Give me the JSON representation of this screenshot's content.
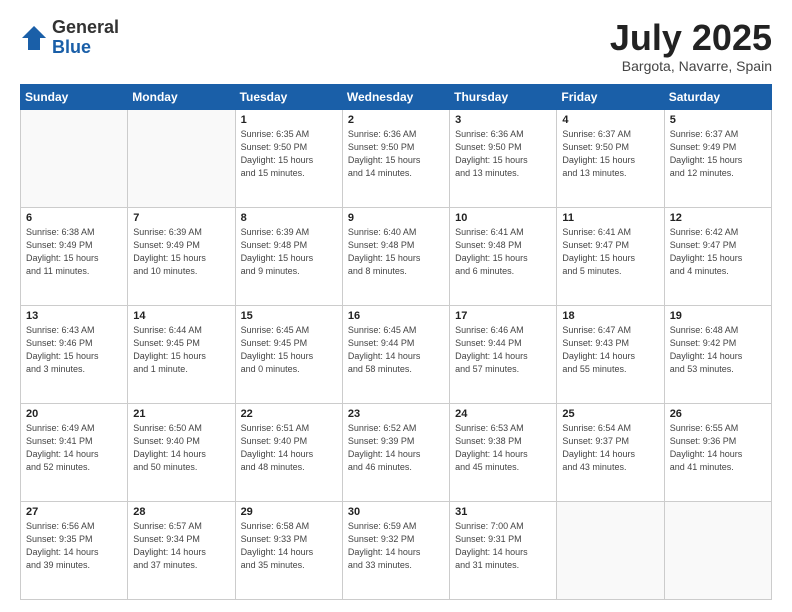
{
  "header": {
    "logo_general": "General",
    "logo_blue": "Blue",
    "month_title": "July 2025",
    "subtitle": "Bargota, Navarre, Spain"
  },
  "weekdays": [
    "Sunday",
    "Monday",
    "Tuesday",
    "Wednesday",
    "Thursday",
    "Friday",
    "Saturday"
  ],
  "weeks": [
    [
      {
        "day": "",
        "info": ""
      },
      {
        "day": "",
        "info": ""
      },
      {
        "day": "1",
        "info": "Sunrise: 6:35 AM\nSunset: 9:50 PM\nDaylight: 15 hours\nand 15 minutes."
      },
      {
        "day": "2",
        "info": "Sunrise: 6:36 AM\nSunset: 9:50 PM\nDaylight: 15 hours\nand 14 minutes."
      },
      {
        "day": "3",
        "info": "Sunrise: 6:36 AM\nSunset: 9:50 PM\nDaylight: 15 hours\nand 13 minutes."
      },
      {
        "day": "4",
        "info": "Sunrise: 6:37 AM\nSunset: 9:50 PM\nDaylight: 15 hours\nand 13 minutes."
      },
      {
        "day": "5",
        "info": "Sunrise: 6:37 AM\nSunset: 9:49 PM\nDaylight: 15 hours\nand 12 minutes."
      }
    ],
    [
      {
        "day": "6",
        "info": "Sunrise: 6:38 AM\nSunset: 9:49 PM\nDaylight: 15 hours\nand 11 minutes."
      },
      {
        "day": "7",
        "info": "Sunrise: 6:39 AM\nSunset: 9:49 PM\nDaylight: 15 hours\nand 10 minutes."
      },
      {
        "day": "8",
        "info": "Sunrise: 6:39 AM\nSunset: 9:48 PM\nDaylight: 15 hours\nand 9 minutes."
      },
      {
        "day": "9",
        "info": "Sunrise: 6:40 AM\nSunset: 9:48 PM\nDaylight: 15 hours\nand 8 minutes."
      },
      {
        "day": "10",
        "info": "Sunrise: 6:41 AM\nSunset: 9:48 PM\nDaylight: 15 hours\nand 6 minutes."
      },
      {
        "day": "11",
        "info": "Sunrise: 6:41 AM\nSunset: 9:47 PM\nDaylight: 15 hours\nand 5 minutes."
      },
      {
        "day": "12",
        "info": "Sunrise: 6:42 AM\nSunset: 9:47 PM\nDaylight: 15 hours\nand 4 minutes."
      }
    ],
    [
      {
        "day": "13",
        "info": "Sunrise: 6:43 AM\nSunset: 9:46 PM\nDaylight: 15 hours\nand 3 minutes."
      },
      {
        "day": "14",
        "info": "Sunrise: 6:44 AM\nSunset: 9:45 PM\nDaylight: 15 hours\nand 1 minute."
      },
      {
        "day": "15",
        "info": "Sunrise: 6:45 AM\nSunset: 9:45 PM\nDaylight: 15 hours\nand 0 minutes."
      },
      {
        "day": "16",
        "info": "Sunrise: 6:45 AM\nSunset: 9:44 PM\nDaylight: 14 hours\nand 58 minutes."
      },
      {
        "day": "17",
        "info": "Sunrise: 6:46 AM\nSunset: 9:44 PM\nDaylight: 14 hours\nand 57 minutes."
      },
      {
        "day": "18",
        "info": "Sunrise: 6:47 AM\nSunset: 9:43 PM\nDaylight: 14 hours\nand 55 minutes."
      },
      {
        "day": "19",
        "info": "Sunrise: 6:48 AM\nSunset: 9:42 PM\nDaylight: 14 hours\nand 53 minutes."
      }
    ],
    [
      {
        "day": "20",
        "info": "Sunrise: 6:49 AM\nSunset: 9:41 PM\nDaylight: 14 hours\nand 52 minutes."
      },
      {
        "day": "21",
        "info": "Sunrise: 6:50 AM\nSunset: 9:40 PM\nDaylight: 14 hours\nand 50 minutes."
      },
      {
        "day": "22",
        "info": "Sunrise: 6:51 AM\nSunset: 9:40 PM\nDaylight: 14 hours\nand 48 minutes."
      },
      {
        "day": "23",
        "info": "Sunrise: 6:52 AM\nSunset: 9:39 PM\nDaylight: 14 hours\nand 46 minutes."
      },
      {
        "day": "24",
        "info": "Sunrise: 6:53 AM\nSunset: 9:38 PM\nDaylight: 14 hours\nand 45 minutes."
      },
      {
        "day": "25",
        "info": "Sunrise: 6:54 AM\nSunset: 9:37 PM\nDaylight: 14 hours\nand 43 minutes."
      },
      {
        "day": "26",
        "info": "Sunrise: 6:55 AM\nSunset: 9:36 PM\nDaylight: 14 hours\nand 41 minutes."
      }
    ],
    [
      {
        "day": "27",
        "info": "Sunrise: 6:56 AM\nSunset: 9:35 PM\nDaylight: 14 hours\nand 39 minutes."
      },
      {
        "day": "28",
        "info": "Sunrise: 6:57 AM\nSunset: 9:34 PM\nDaylight: 14 hours\nand 37 minutes."
      },
      {
        "day": "29",
        "info": "Sunrise: 6:58 AM\nSunset: 9:33 PM\nDaylight: 14 hours\nand 35 minutes."
      },
      {
        "day": "30",
        "info": "Sunrise: 6:59 AM\nSunset: 9:32 PM\nDaylight: 14 hours\nand 33 minutes."
      },
      {
        "day": "31",
        "info": "Sunrise: 7:00 AM\nSunset: 9:31 PM\nDaylight: 14 hours\nand 31 minutes."
      },
      {
        "day": "",
        "info": ""
      },
      {
        "day": "",
        "info": ""
      }
    ]
  ]
}
